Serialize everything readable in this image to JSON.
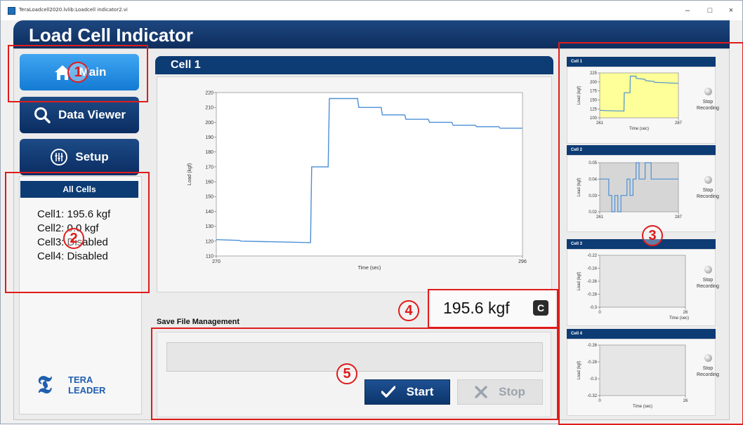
{
  "window": {
    "title": "TeraLoadcell2020.lvlib:Loadcell indicator2.vi",
    "minimize": "–",
    "maximize": "□",
    "close": "×"
  },
  "header": {
    "title": "Load Cell Indicator"
  },
  "nav": {
    "main": "Main",
    "data_viewer": "Data Viewer",
    "setup": "Setup"
  },
  "all_cells": {
    "title": "All Cells",
    "lines": [
      "Cell1: 195.6 kgf",
      "Cell2: 0.0 kgf",
      "Cell3: Disabled",
      "Cell4: Disabled"
    ]
  },
  "logo": {
    "line1": "TERA",
    "line2": "LEADER"
  },
  "main_panel": {
    "title": "Cell 1",
    "reading": "195.6 kgf",
    "reading_icon": "C"
  },
  "chart_data": [
    {
      "name": "main",
      "type": "line",
      "xlabel": "Time (sec)",
      "ylabel": "Load (kgf)",
      "xlim": [
        270,
        296
      ],
      "ylim": [
        110,
        220
      ],
      "xticks": [
        "270",
        "296"
      ],
      "yticks": [
        "110",
        "120",
        "130",
        "140",
        "150",
        "160",
        "170",
        "180",
        "190",
        "200",
        "210",
        "220"
      ],
      "color": "#4b8fd6",
      "x": [
        270,
        272,
        272.1,
        278,
        278.1,
        279.5,
        279.6,
        282,
        282.1,
        284,
        284.1,
        286,
        286.1,
        288,
        288.1,
        290,
        290.1,
        292,
        292.1,
        294,
        294.1,
        296
      ],
      "y": [
        121,
        120.5,
        120,
        119,
        170,
        170,
        216,
        216,
        210,
        210,
        205,
        205,
        202,
        202,
        200,
        200,
        198,
        198,
        197,
        197,
        196,
        196
      ]
    },
    {
      "name": "cell1",
      "type": "line",
      "title": "Cell 1",
      "xlabel": "Time (sec)",
      "ylabel": "Load (kgf)",
      "xlim": [
        261,
        287
      ],
      "ylim": [
        100,
        225
      ],
      "xticks": [
        "261",
        "287"
      ],
      "yticks": [
        "100",
        "125",
        "150",
        "175",
        "200",
        "225"
      ],
      "bg": "#ffff99",
      "color": "#4b8fd6",
      "x": [
        261,
        263,
        263.1,
        269,
        269.1,
        271,
        271.1,
        273,
        273.1,
        276,
        276.1,
        279,
        279.1,
        287
      ],
      "y": [
        121,
        120,
        120,
        119,
        170,
        170,
        216,
        216,
        210,
        207,
        204,
        201,
        199,
        196
      ]
    },
    {
      "name": "cell2",
      "type": "line",
      "title": "Cell 2",
      "xlabel": "",
      "ylabel": "Load (kgf)",
      "xlim": [
        261,
        287
      ],
      "ylim": [
        0.02,
        0.05
      ],
      "xticks": [
        "261",
        "287"
      ],
      "yticks": [
        "0.02",
        "0.03",
        "0.04",
        "0.05"
      ],
      "bg": "#d6d6d6",
      "color": "#4b8fd6",
      "x": [
        261,
        264,
        264,
        265,
        265,
        266,
        266,
        267,
        267,
        268,
        268,
        270,
        270,
        271,
        271,
        272,
        272,
        273,
        273,
        274,
        274,
        276,
        276,
        278,
        278,
        279,
        279,
        287
      ],
      "y": [
        0.04,
        0.04,
        0.03,
        0.03,
        0.02,
        0.02,
        0.03,
        0.03,
        0.02,
        0.02,
        0.03,
        0.03,
        0.04,
        0.04,
        0.03,
        0.03,
        0.04,
        0.04,
        0.05,
        0.05,
        0.04,
        0.04,
        0.05,
        0.05,
        0.04,
        0.04,
        0.04,
        0.04
      ]
    },
    {
      "name": "cell3",
      "type": "line",
      "title": "Cell 3",
      "xlabel": "Time (sec)",
      "ylabel": "Load (kgf)",
      "xlim": [
        0,
        26
      ],
      "ylim": [
        -0.3,
        -0.22
      ],
      "xticks": [
        "0",
        "26"
      ],
      "yticks": [
        "-0.3",
        "-0.28",
        "-0.26",
        "-0.24",
        "-0.22"
      ],
      "bg": "#e6e6e6",
      "x": [],
      "y": []
    },
    {
      "name": "cell4",
      "type": "line",
      "title": "Cell 4",
      "xlabel": "Time (sec)",
      "ylabel": "Load (kgf)",
      "xlim": [
        0,
        26
      ],
      "ylim": [
        -0.32,
        -0.26
      ],
      "xticks": [
        "0",
        "26"
      ],
      "yticks": [
        "-0.32",
        "-0.3",
        "-0.28",
        "-0.26"
      ],
      "bg": "#e6e6e6",
      "x": [],
      "y": []
    }
  ],
  "cells_mini": [
    {
      "title": "Cell 1",
      "stop": "Stop",
      "recording": "Recording"
    },
    {
      "title": "Cell 2",
      "stop": "Stop",
      "recording": "Recording"
    },
    {
      "title": "Cell 3",
      "stop": "Stop",
      "recording": "Recording"
    },
    {
      "title": "Cell 4",
      "stop": "Stop",
      "recording": "Recording"
    }
  ],
  "save_file": {
    "label": "Save File Management",
    "path_value": "",
    "start": "Start",
    "stop": "Stop"
  },
  "annotations": [
    "1",
    "2",
    "3",
    "4",
    "5"
  ],
  "colors": {
    "accent": "#0d3b74",
    "highlight": "#e01b1b",
    "main_button": "#2a92e6"
  }
}
